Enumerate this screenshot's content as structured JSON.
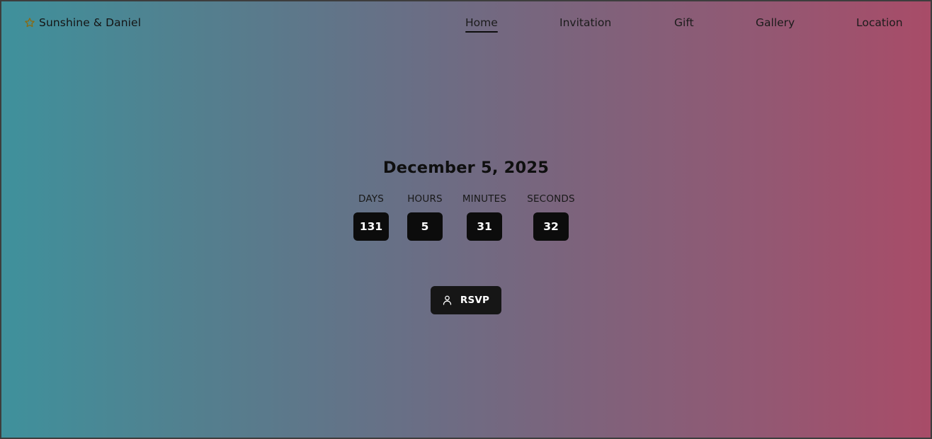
{
  "header": {
    "brand_icon": "star-outline-icon",
    "brand_icon_color": "#8a6a12",
    "brand_name": "Sunshine & Daniel",
    "nav": [
      {
        "label": "Home",
        "active": true
      },
      {
        "label": "Invitation",
        "active": false
      },
      {
        "label": "Gift",
        "active": false
      },
      {
        "label": "Gallery",
        "active": false
      },
      {
        "label": "Location",
        "active": false
      }
    ]
  },
  "hero": {
    "date": "December 5, 2025",
    "countdown": [
      {
        "label": "DAYS",
        "value": "131"
      },
      {
        "label": "HOURS",
        "value": "5"
      },
      {
        "label": "MINUTES",
        "value": "31"
      },
      {
        "label": "SECONDS",
        "value": "32"
      }
    ],
    "rsvp_icon": "user-icon",
    "rsvp_label": "RSVP"
  },
  "colors": {
    "gradient_left": "#3f919c",
    "gradient_mid": "#6a6e85",
    "gradient_right": "#a84c68",
    "countdown_box": "#0c0c0c",
    "button_bg": "#161616"
  }
}
